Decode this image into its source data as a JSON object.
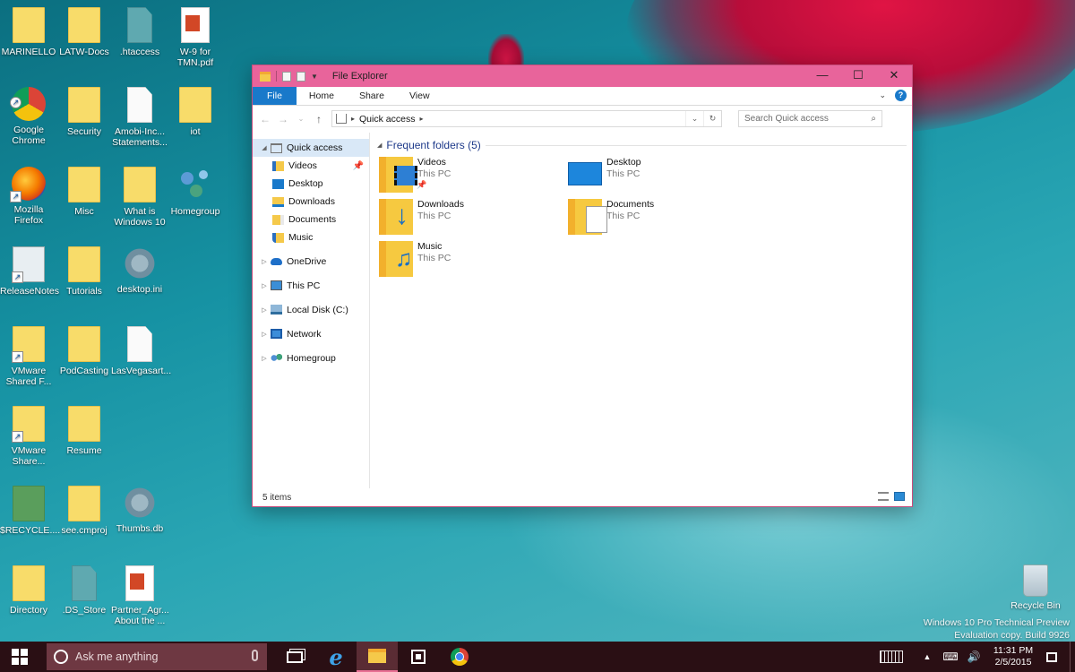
{
  "desktop": {
    "icons": [
      {
        "label": "MARINELLO",
        "icon": "folder-icon"
      },
      {
        "label": "LATW-Docs",
        "icon": "folder-icon"
      },
      {
        "label": ".htaccess",
        "icon": "file-icon"
      },
      {
        "label": "W-9 for TMN.pdf",
        "icon": "pdf-icon"
      },
      {
        "label": "Google Chrome",
        "icon": "chrome-icon"
      },
      {
        "label": "Security",
        "icon": "folder-icon"
      },
      {
        "label": "Amobi-Inc... Statements...",
        "icon": "file-icon"
      },
      {
        "label": "iot",
        "icon": "folder-icon"
      },
      {
        "label": "Mozilla Firefox",
        "icon": "firefox-icon"
      },
      {
        "label": "Misc",
        "icon": "folder-icon"
      },
      {
        "label": "What is Windows 10",
        "icon": "folder-icon"
      },
      {
        "label": "Homegroup",
        "icon": "homegroup-icon"
      },
      {
        "label": "ReleaseNotes",
        "icon": "release-notes-icon"
      },
      {
        "label": "Tutorials",
        "icon": "folder-icon"
      },
      {
        "label": "desktop.ini",
        "icon": "settings-file-icon"
      },
      {
        "label": "VMware Shared F...",
        "icon": "folder-icon"
      },
      {
        "label": "PodCasting",
        "icon": "folder-icon"
      },
      {
        "label": "LasVegasart...",
        "icon": "file-icon"
      },
      {
        "label": "VMware Share...",
        "icon": "folder-icon"
      },
      {
        "label": "Resume",
        "icon": "folder-icon"
      },
      {
        "label": "$RECYCLE....",
        "icon": "recycle-folder-icon"
      },
      {
        "label": "see.cmproj",
        "icon": "folder-icon"
      },
      {
        "label": "Thumbs.db",
        "icon": "settings-file-icon"
      },
      {
        "label": "Directory",
        "icon": "folder-icon"
      },
      {
        "label": ".DS_Store",
        "icon": "file-icon"
      },
      {
        "label": "Partner_Agr... About the ...",
        "icon": "pdf-icon"
      }
    ],
    "recycle_bin": "Recycle Bin",
    "watermark_line1": "Windows 10 Pro Technical Preview",
    "watermark_line2": "Evaluation copy. Build 9926"
  },
  "explorer": {
    "title": "File Explorer",
    "ribbon_tabs": [
      "File",
      "Home",
      "Share",
      "View"
    ],
    "address_location": "Quick access",
    "search_placeholder": "Search Quick access",
    "nav": {
      "quick_access": "Quick access",
      "children": [
        "Videos",
        "Desktop",
        "Downloads",
        "Documents",
        "Music"
      ],
      "roots": [
        "OneDrive",
        "This PC",
        "Local Disk (C:)",
        "Network",
        "Homegroup"
      ]
    },
    "group_title": "Frequent folders (5)",
    "folders": [
      {
        "name": "Videos",
        "location": "This PC"
      },
      {
        "name": "Desktop",
        "location": "This PC"
      },
      {
        "name": "Downloads",
        "location": "This PC"
      },
      {
        "name": "Documents",
        "location": "This PC"
      },
      {
        "name": "Music",
        "location": "This PC"
      }
    ],
    "status": "5 items"
  },
  "taskbar": {
    "search_placeholder": "Ask me anything",
    "time": "11:31 PM",
    "date": "2/5/2015"
  },
  "colors": {
    "titlebar": "#e8649b",
    "accent": "#1979ca",
    "taskbar": "#2a0f14"
  }
}
